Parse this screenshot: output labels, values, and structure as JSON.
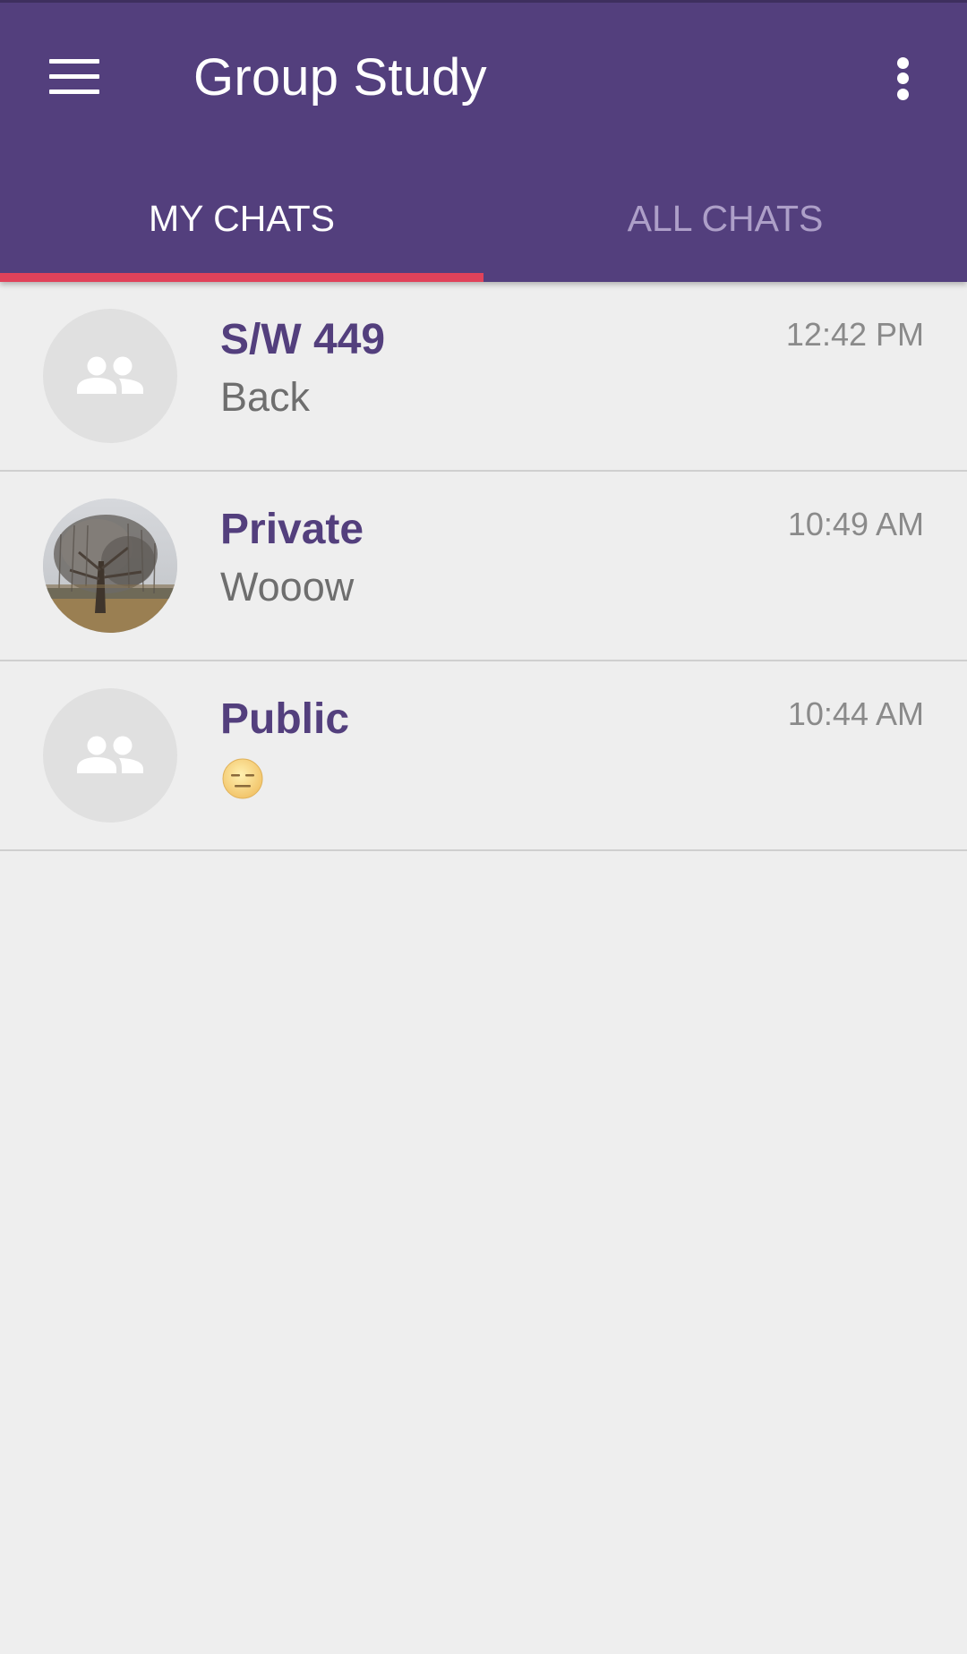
{
  "app": {
    "title": "Group Study",
    "menu_icon": "hamburger-menu-icon",
    "overflow_icon": "more-vert-icon"
  },
  "colors": {
    "primary": "#533f7d",
    "accent": "#e0425a",
    "background": "#eeeeee",
    "inactive_tab": "#ad9fc8"
  },
  "tabs": [
    {
      "label": "MY CHATS",
      "selected": true
    },
    {
      "label": "ALL CHATS",
      "selected": false
    }
  ],
  "chats": [
    {
      "name": "S/W 449",
      "last_message": "Back",
      "time": "12:42 PM",
      "avatar": "group-icon"
    },
    {
      "name": "Private",
      "last_message": "Wooow",
      "time": "10:49 AM",
      "avatar": "tree-photo"
    },
    {
      "name": "Public",
      "last_message": "",
      "last_message_emoji": "expressionless-face-emoji",
      "time": "10:44 AM",
      "avatar": "group-icon"
    }
  ]
}
